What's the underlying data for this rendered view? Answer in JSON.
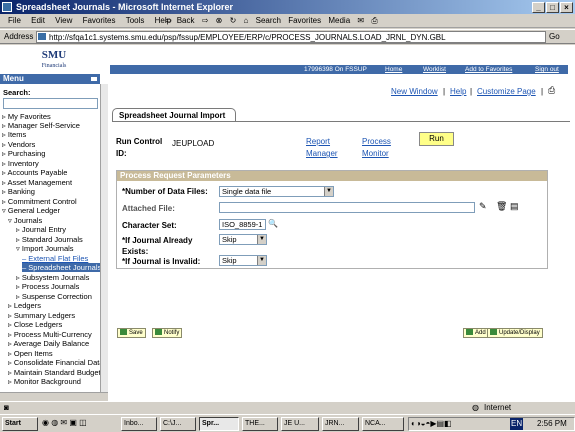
{
  "window": {
    "title": "Spreadsheet Journals - Microsoft Internet Explorer",
    "min_label": "_",
    "max_label": "□",
    "close_label": "×"
  },
  "menubar": [
    "File",
    "Edit",
    "View",
    "Favorites",
    "Tools",
    "Help"
  ],
  "toolbar": {
    "back": "Back",
    "search": "Search",
    "favorites": "Favorites",
    "media": "Media"
  },
  "address": {
    "label": "Address",
    "url": "http://sfqa1c1.systems.smu.edu/psp/fssup/EMPLOYEE/ERP/c/PROCESS_JOURNALS.LOAD_JRNL_DYN.GBL",
    "go": "Go"
  },
  "logo": {
    "name": "SMU",
    "sub": "Financials"
  },
  "navbar": {
    "user": "17996398 On FSSUP",
    "home": "Home",
    "worklist": "Worklist",
    "favorites": "Add to Favorites",
    "signout": "Sign out"
  },
  "menu": {
    "title": "Menu",
    "search_label": "Search:",
    "items": [
      "My Favorites",
      "Manager Self-Service",
      "Items",
      "Vendors",
      "Purchasing",
      "Inventory",
      "Accounts Payable",
      "Asset Management",
      "Banking",
      "Commitment Control",
      "General Ledger",
      "Journals",
      "Journal Entry",
      "Standard Journals",
      "Import Journals",
      "External Flat Files",
      "Spreadsheet Journals",
      "Subsystem Journals",
      "Process Journals",
      "Suspense Correction",
      "Ledgers",
      "Summary Ledgers",
      "Close Ledgers",
      "Process Multi-Currency",
      "Average Daily Balance",
      "Open Items",
      "Consolidate Financial Data",
      "Maintain Standard Budgets",
      "Monitor Background"
    ]
  },
  "top_links": {
    "new_window": "New Window",
    "help": "Help",
    "customize": "Customize Page"
  },
  "page": {
    "tab_label": "Spreadsheet Journal Import",
    "run_control_label": "Run Control ID:",
    "run_control_value": "JEUPLOAD",
    "report_manager": "Report Manager",
    "process_monitor": "Process Monitor",
    "run_button": "Run"
  },
  "params": {
    "header": "Process Request Parameters",
    "num_files_label": "*Number of Data Files:",
    "num_files_value": "Single data file",
    "attached_label": "Attached File:",
    "attached_value": "",
    "charset_label": "Character Set:",
    "charset_value": "ISO_8859-1",
    "if_exists_label": "*If Journal Already Exists:",
    "if_exists_value": "Skip",
    "if_invalid_label": "*If Journal is Invalid:",
    "if_invalid_value": "Skip"
  },
  "buttons": {
    "save": "Save",
    "notify": "Notify",
    "add": "Add",
    "update": "Update/Display"
  },
  "status": {
    "zone": "Internet"
  },
  "taskbar": {
    "start": "Start",
    "items": [
      "Inbo...",
      "C:\\J...",
      "Spr...",
      "THE...",
      "JE U...",
      "JRN...",
      "NCA..."
    ],
    "clock": "2:56 PM",
    "lang": "EN"
  }
}
